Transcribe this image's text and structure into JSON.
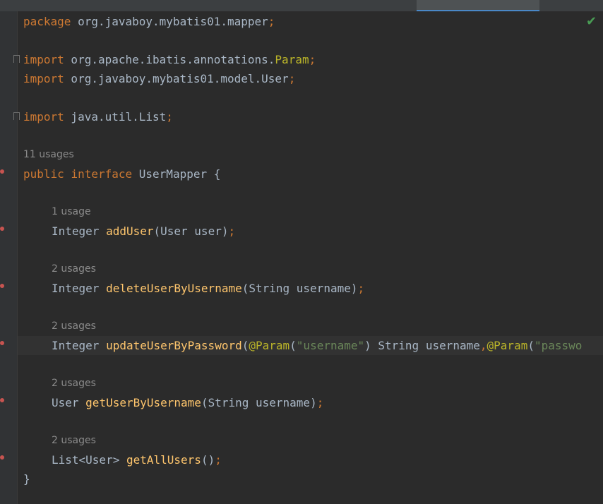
{
  "editor": {
    "status": {
      "icon": "inspection-ok-icon",
      "color": "#499c54"
    },
    "package_line": {
      "kw": "package",
      "name": " org.javaboy.mybatis01.mapper",
      "semi": ";"
    },
    "import1": {
      "kw": "import",
      "path": " org.apache.ibatis.annotations.",
      "cls": "Param",
      "semi": ";"
    },
    "import2": {
      "kw": "import",
      "path": " org.javaboy.mybatis01.model.User",
      "semi": ";"
    },
    "import3": {
      "kw": "import",
      "path": " java.util.List",
      "semi": ";"
    },
    "interface_hint": "11 usages",
    "interface_line": {
      "kw1": "public",
      "kw2": "interface",
      "name": " UserMapper {"
    },
    "methods": [
      {
        "hint": "1 usage",
        "ret": "Integer ",
        "name": "addUser",
        "params": "(User user)",
        "semi": ";"
      },
      {
        "hint": "2 usages",
        "ret": "Integer ",
        "name": "deleteUserByUsername",
        "params": "(String username)",
        "semi": ";"
      },
      {
        "hint": "2 usages",
        "ret": "Integer ",
        "name": "updateUserByPassword",
        "p1": "(",
        "ann1": "@Param",
        "p2": "(",
        "str1": "\"username\"",
        "p3": ") String username",
        "comma": ",",
        "ann2": "@Param",
        "p4": "(",
        "str2": "\"passwo"
      },
      {
        "hint": "2 usages",
        "ret": "User ",
        "name": "getUserByUsername",
        "params": "(String username)",
        "semi": ";"
      },
      {
        "hint": "2 usages",
        "ret": "List<User> ",
        "name": "getAllUsers",
        "params": "()",
        "semi": ";"
      }
    ],
    "closing_brace": "}"
  }
}
